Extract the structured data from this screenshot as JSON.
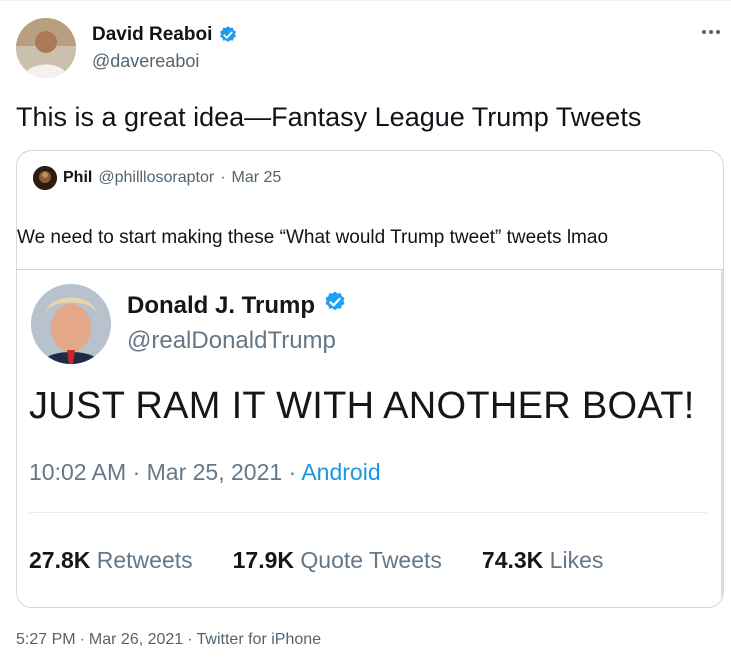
{
  "author": {
    "name": "David Reaboi",
    "handle": "@davereaboi",
    "verified_icon": "verified-badge-icon"
  },
  "more_icon": "more-options-icon",
  "tweet": {
    "text": "This is a great idea—Fantasy League Trump Tweets",
    "footer_time": "5:27 PM",
    "footer_date": "Mar 26, 2021",
    "footer_source": "Twitter for iPhone"
  },
  "quote": {
    "name": "Phil",
    "handle": "@philllosoraptor",
    "date": "Mar 25",
    "text": "We need to start making these “What would Trump tweet” tweets lmao",
    "screenshot": {
      "name": "Donald J. Trump",
      "handle": "@realDonaldTrump",
      "text": "JUST RAM IT WITH ANOTHER BOAT!",
      "time": "10:02 AM",
      "date": "Mar 25, 2021",
      "source": "Android",
      "stats": [
        {
          "count": "27.8K",
          "label": "Retweets"
        },
        {
          "count": "17.9K",
          "label": "Quote Tweets"
        },
        {
          "count": "74.3K",
          "label": "Likes"
        }
      ]
    }
  },
  "colors": {
    "verified": "#1d9bf0",
    "muted": "#536471",
    "link": "#1b95e0",
    "border": "#cfd9de"
  }
}
